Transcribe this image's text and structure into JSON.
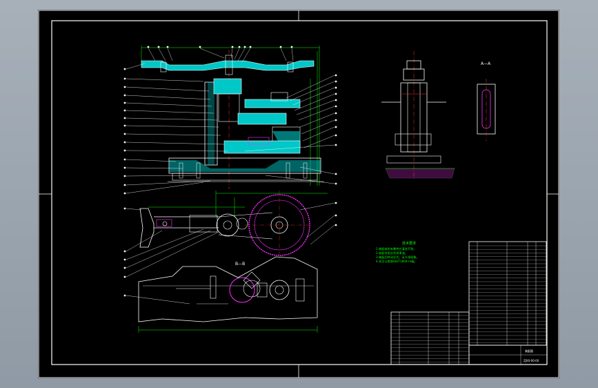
{
  "drawing": {
    "section_label_top_right": "A—A",
    "section_label_bottom": "B—B",
    "tech_requirements_title": "技术要求",
    "tech_requirements_lines": [
      "1.装配前所有零件应清洗干净。",
      "2.各配合面应涂润滑油。",
      "3.装配后转动灵活，无卡滞现象。",
      "4.未注公差按GB/T1804-m级。"
    ],
    "title_block": {
      "drawing_name": "装配图",
      "drawing_number": "ZJXX-00-00"
    }
  },
  "colors": {
    "background": "#000000",
    "frame": "#ffffff",
    "outline": "#ffffff",
    "section": "#00d0d0",
    "dimension": "#00ff00",
    "center": "#ff3030",
    "hidden": "#ff30ff",
    "leader": "#ffffff"
  }
}
